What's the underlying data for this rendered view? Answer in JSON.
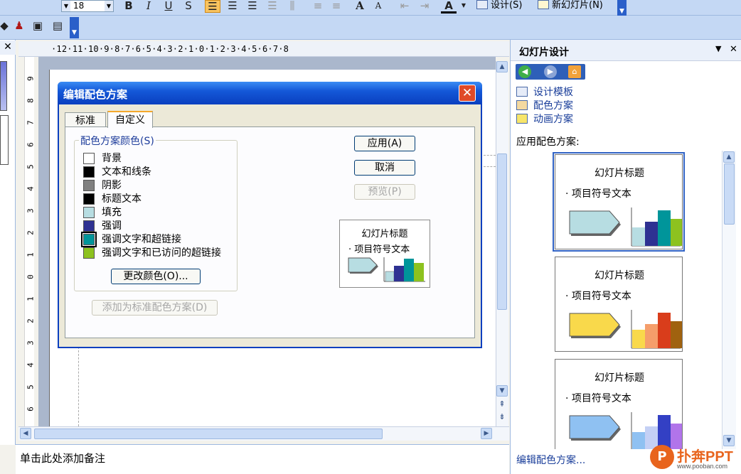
{
  "toolbar": {
    "font_size": "18",
    "design_label": "设计(S)",
    "new_slide_label": "新幻灯片(N)"
  },
  "ruler": {
    "horizontal": "·12·11·10·9·8·7·6·5·4·3·2·1·0·1·2·3·4·5·6·7·8",
    "vertical": [
      "9",
      "8",
      "7",
      "6",
      "5",
      "4",
      "3",
      "2",
      "1",
      "0",
      "1",
      "2",
      "3",
      "4",
      "5",
      "6"
    ]
  },
  "notes": {
    "placeholder": "单击此处添加备注"
  },
  "taskpane": {
    "title": "幻灯片设计",
    "links": [
      "设计模板",
      "配色方案",
      "动画方案"
    ],
    "apply_label": "应用配色方案:",
    "edit_link": "编辑配色方案...",
    "scheme_title": "幻灯片标题",
    "scheme_bullet": "· 项目符号文本",
    "schemes": [
      {
        "arrow": "#b7dde2",
        "bars": [
          "#b7dde2",
          "#2e3192",
          "#00959a",
          "#8dc21f"
        ]
      },
      {
        "arrow": "#f9d94b",
        "bars": [
          "#f9d94b",
          "#f59e6b",
          "#d93d1b",
          "#a0620f"
        ]
      },
      {
        "arrow": "#8fc1f2",
        "bars": [
          "#8fc1f2",
          "#c4d0f5",
          "#3340c4",
          "#b174ea"
        ]
      }
    ]
  },
  "dialog": {
    "title": "编辑配色方案",
    "tabs": [
      "标准",
      "自定义"
    ],
    "group_label": "配色方案颜色(S)",
    "colors": [
      {
        "label": "背景",
        "hex": "#ffffff"
      },
      {
        "label": "文本和线条",
        "hex": "#000000"
      },
      {
        "label": "阴影",
        "hex": "#808080"
      },
      {
        "label": "标题文本",
        "hex": "#000000"
      },
      {
        "label": "填充",
        "hex": "#b7dde2"
      },
      {
        "label": "强调",
        "hex": "#2e3192"
      },
      {
        "label": "强调文字和超链接",
        "hex": "#00959a"
      },
      {
        "label": "强调文字和已访问的超链接",
        "hex": "#8dc21f"
      }
    ],
    "change_color_label": "更改颜色(O)...",
    "add_standard_label": "添加为标准配色方案(D)",
    "apply_label": "应用(A)",
    "cancel_label": "取消",
    "preview_label": "预览(P)",
    "preview_title": "幻灯片标题",
    "preview_bullet": "· 项目符号文本"
  },
  "watermark": {
    "brand": "扑奔PPT",
    "url": "www.pooban.com"
  }
}
